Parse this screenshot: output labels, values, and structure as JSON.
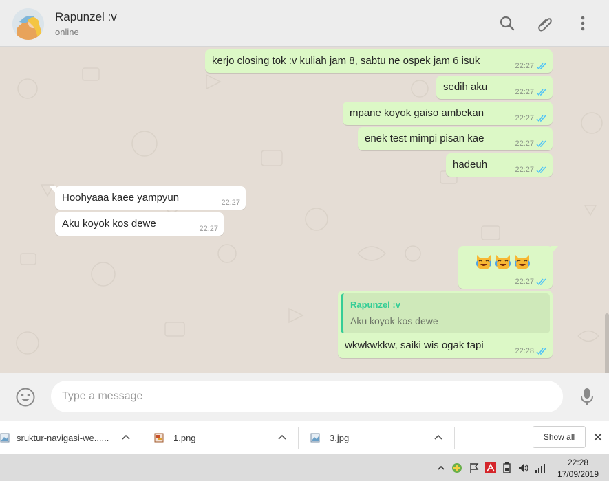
{
  "header": {
    "contact_name": "Rapunzel :v",
    "status": "online",
    "icons": [
      "search-icon",
      "attach-icon",
      "menu-icon"
    ]
  },
  "messages": [
    {
      "direction": "out",
      "text": "kerjo closing tok :v kuliah jam 8, sabtu ne ospek jam 6 isuk",
      "time": "22:27",
      "read": true
    },
    {
      "direction": "out",
      "text": "sedih aku",
      "time": "22:27",
      "read": true
    },
    {
      "direction": "out",
      "text": "mpane koyok gaiso ambekan",
      "time": "22:27",
      "read": true
    },
    {
      "direction": "out",
      "text": "enek test mimpi pisan kae",
      "time": "22:27",
      "read": true
    },
    {
      "direction": "out",
      "text": "hadeuh",
      "time": "22:27",
      "read": true
    },
    {
      "direction": "in",
      "text": "Hoohyaaa kaee yampyun",
      "time": "22:27"
    },
    {
      "direction": "in",
      "text": "Aku koyok kos dewe",
      "time": "22:27"
    },
    {
      "direction": "out",
      "emoji": "😹😹😹",
      "time": "22:27",
      "read": true
    },
    {
      "direction": "out",
      "text": "wkwkwkkw, saiki wis ogak tapi",
      "time": "22:28",
      "read": true,
      "quote": {
        "name": "Rapunzel :v",
        "text": "Aku koyok kos dewe"
      }
    }
  ],
  "composer": {
    "placeholder": "Type a message"
  },
  "downloads": {
    "items": [
      {
        "name": "sruktur-navigasi-we......",
        "icon": "image-file-icon"
      },
      {
        "name": "1.png",
        "icon": "image-file-icon"
      },
      {
        "name": "3.jpg",
        "icon": "image-file-icon"
      }
    ],
    "show_all_label": "Show all"
  },
  "taskbar": {
    "time": "22:28",
    "date": "17/09/2019"
  },
  "colors": {
    "outgoing_bubble": "#dcf8c6",
    "incoming_bubble": "#ffffff",
    "chat_background": "#e5ddd5",
    "read_tick": "#4fc3f7",
    "quote_accent": "#35cd96"
  }
}
